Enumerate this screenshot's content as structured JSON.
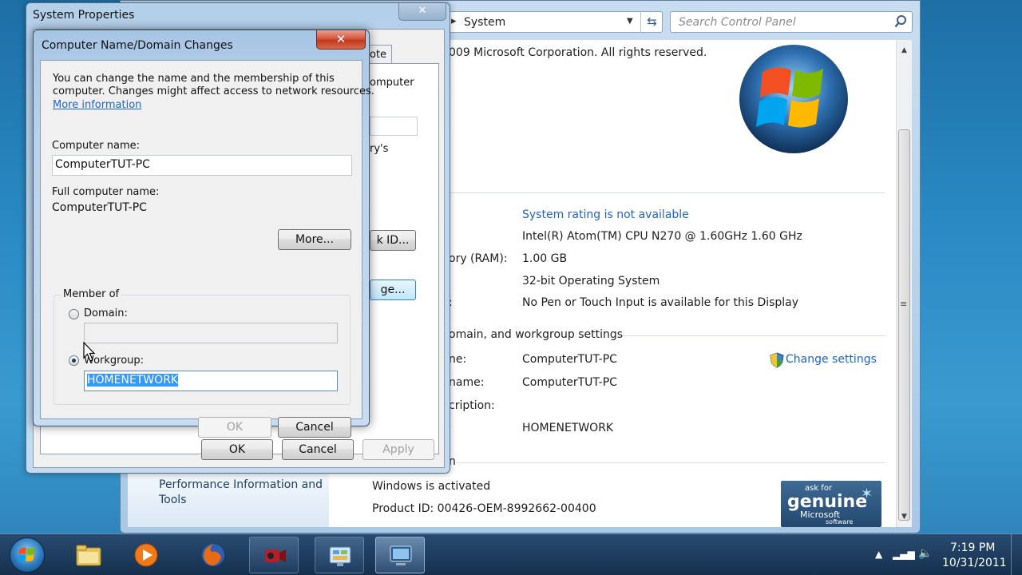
{
  "control_panel": {
    "address": "System",
    "search_placeholder": "Search Control Panel",
    "copyright": "009 Microsoft Corporation.  All rights reserved.",
    "rating": "System rating is not available",
    "processor": "Intel(R) Atom(TM) CPU N270   @ 1.60GHz   1.60 GHz",
    "memory_label": "ory (RAM):",
    "memory": "1.00 GB",
    "system_type": "32-bit Operating System",
    "pen_label": ":",
    "pen": "No Pen or Touch Input is available for this Display",
    "section_name": "omain, and workgroup settings",
    "name_label": "ne:",
    "computer_name": "ComputerTUT-PC",
    "full_name_label": "name:",
    "full_name": "ComputerTUT-PC",
    "description_label": "cription:",
    "workgroup": "HOMENETWORK",
    "change_settings": "Change settings",
    "activation_label": "n",
    "sidebar_link": "Performance Information and Tools",
    "activated": "Windows is activated",
    "product_id": "Product ID: 00426-OEM-8992662-00400",
    "genuine": {
      "ask": "ask for",
      "genuine": "genuine",
      "microsoft": "Microsoft",
      "software": "software"
    }
  },
  "system_properties": {
    "title": "System Properties",
    "tab_fragment": "ote",
    "frag_computer": "omputer",
    "frag_ys": "ry's",
    "network_id": "k ID...",
    "change": "ge...",
    "ok": "OK",
    "cancel": "Cancel",
    "apply": "Apply"
  },
  "dialog": {
    "title": "Computer Name/Domain Changes",
    "intro_line1": "You can change the name and the membership of this",
    "intro_line2": "computer. Changes might affect access to network resources.",
    "more_info": "More information",
    "computer_name_label": "Computer name:",
    "computer_name_value": "ComputerTUT-PC",
    "full_name_label": "Full computer name:",
    "full_name_value": "ComputerTUT-PC",
    "more_button": "More...",
    "member_of": "Member of",
    "domain_label": "Domain:",
    "domain_value": "",
    "workgroup_label": "Workgroup:",
    "workgroup_value": "HOMENETWORK",
    "ok": "OK",
    "cancel": "Cancel"
  },
  "taskbar": {
    "time": "7:19 PM",
    "date": "10/31/2011"
  }
}
